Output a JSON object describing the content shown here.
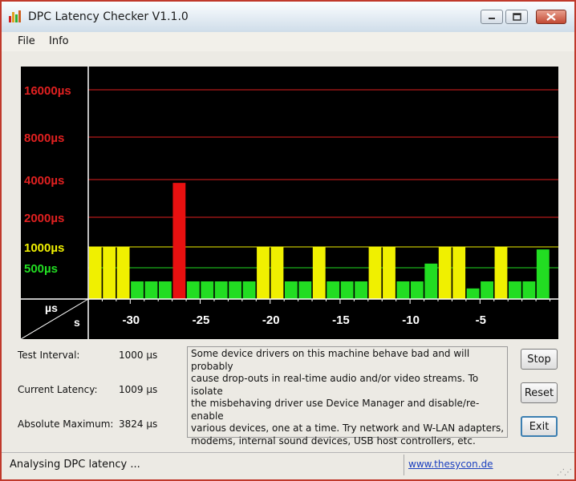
{
  "window": {
    "title": "DPC Latency Checker V1.1.0"
  },
  "menu": {
    "file": "File",
    "info": "Info"
  },
  "chart_data": {
    "type": "bar",
    "ylabel": "µs",
    "xlabel": "s",
    "y_ticks": [
      {
        "value": 16000,
        "label": "16000µs",
        "color": "#e02020"
      },
      {
        "value": 8000,
        "label": "8000µs",
        "color": "#e02020"
      },
      {
        "value": 4000,
        "label": "4000µs",
        "color": "#e02020"
      },
      {
        "value": 2000,
        "label": "2000µs",
        "color": "#e02020"
      },
      {
        "value": 1000,
        "label": "1000µs",
        "color": "#f0f000"
      },
      {
        "value": 500,
        "label": "500µs",
        "color": "#22dd22"
      }
    ],
    "x_ticks": [
      -30,
      -25,
      -20,
      -15,
      -10,
      -5
    ],
    "x_range": [
      -33,
      0
    ],
    "x": [
      -33,
      -32,
      -31,
      -30,
      -29,
      -28,
      -27,
      -26,
      -25,
      -24,
      -23,
      -22,
      -21,
      -20,
      -19,
      -18,
      -17,
      -16,
      -15,
      -14,
      -13,
      -12,
      -11,
      -10,
      -9,
      -8,
      -7,
      -6,
      -5,
      -4,
      -3,
      -2,
      -1
    ],
    "values": [
      1000,
      1000,
      1000,
      250,
      250,
      250,
      3824,
      250,
      250,
      250,
      250,
      250,
      1000,
      1000,
      250,
      250,
      1000,
      250,
      250,
      250,
      1000,
      1000,
      250,
      250,
      600,
      1000,
      1000,
      150,
      250,
      1000,
      250,
      250,
      940
    ],
    "colors": {
      "green": "#22dd22",
      "yellow": "#f0f000",
      "red": "#e81010"
    },
    "background": "#000000"
  },
  "info": {
    "test_interval_label": "Test Interval:",
    "test_interval_value": "1000 µs",
    "current_latency_label": "Current Latency:",
    "current_latency_value": "1009 µs",
    "absolute_max_label": "Absolute Maximum:",
    "absolute_max_value": "3824 µs"
  },
  "message_lines": [
    "Some device drivers on this machine behave bad and will probably",
    "cause drop-outs in real-time audio and/or video streams. To isolate",
    "the misbehaving driver use Device Manager and disable/re-enable",
    "various devices, one at a time. Try network and W-LAN adapters,",
    "modems, internal sound devices, USB host controllers, etc."
  ],
  "buttons": {
    "stop": "Stop",
    "reset": "Reset",
    "exit": "Exit"
  },
  "status": {
    "text": "Analysing DPC latency ...",
    "link": "www.thesycon.de"
  }
}
